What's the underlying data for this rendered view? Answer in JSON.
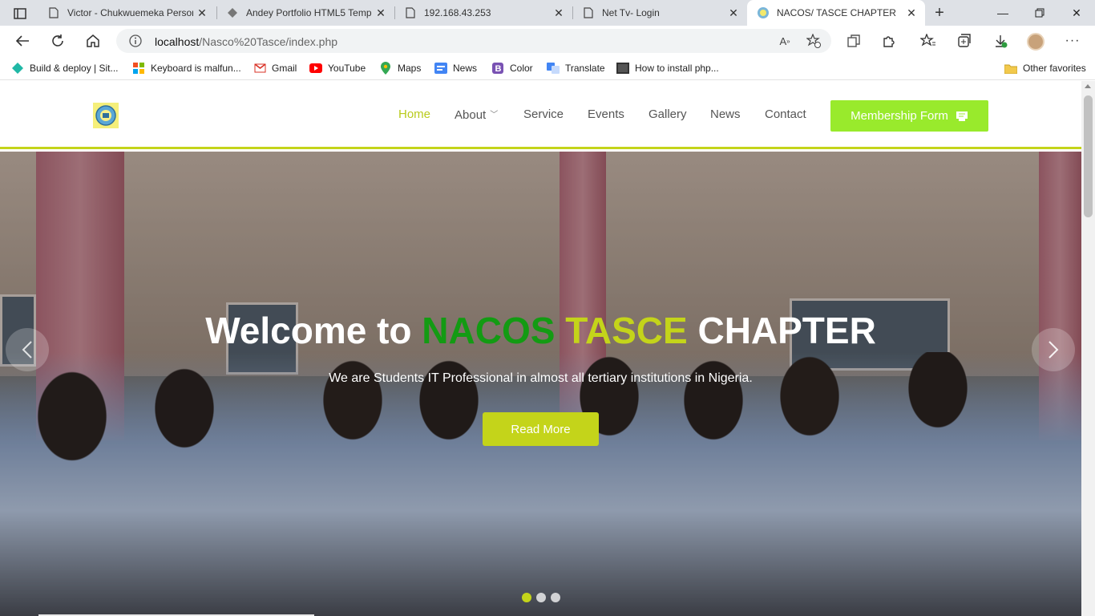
{
  "browser": {
    "tabs": [
      {
        "title": "Victor - Chukwuemeka Person",
        "icon": "page-icon"
      },
      {
        "title": "Andey Portfolio HTML5 Temp",
        "icon": "template-icon"
      },
      {
        "title": "192.168.43.253",
        "icon": "page-icon"
      },
      {
        "title": "Net Tv- Login",
        "icon": "page-icon"
      },
      {
        "title": "NACOS/ TASCE CHAPTER",
        "icon": "nacos-logo-icon",
        "active": true
      }
    ],
    "url_host": "localhost",
    "url_path": "/Nasco%20Tasce/index.php",
    "bookmarks": [
      {
        "label": "Build & deploy | Sit...",
        "icon": "netlify-icon",
        "color": "#20b8a6"
      },
      {
        "label": "Keyboard is malfun...",
        "icon": "windows-icon",
        "color": "#f25022"
      },
      {
        "label": "Gmail",
        "icon": "gmail-icon",
        "color": "#d93025"
      },
      {
        "label": "YouTube",
        "icon": "youtube-icon",
        "color": "#ff0000"
      },
      {
        "label": "Maps",
        "icon": "maps-icon",
        "color": "#34a853"
      },
      {
        "label": "News",
        "icon": "news-icon",
        "color": "#4285f4"
      },
      {
        "label": "Color",
        "icon": "bootstrap-icon",
        "color": "#7952b3"
      },
      {
        "label": "Translate",
        "icon": "translate-icon",
        "color": "#4285f4"
      },
      {
        "label": "How to install php...",
        "icon": "video-icon",
        "color": "#333333"
      }
    ],
    "other_favorites": "Other favorites"
  },
  "site": {
    "nav": {
      "home": "Home",
      "about": "About",
      "service": "Service",
      "events": "Events",
      "gallery": "Gallery",
      "news": "News",
      "contact": "Contact",
      "membership": "Membership Form"
    },
    "hero": {
      "title_prefix": "Welcome to ",
      "title_green": "NACOS",
      "title_yellow": "TASCE",
      "title_suffix": "CHAPTER",
      "subtitle": "We are Students IT Professional in almost all tertiary institutions in Nigeria.",
      "button": "Read More",
      "slides": 3,
      "active_slide": 1
    }
  },
  "colors": {
    "accent_yellow": "#c4d41a",
    "accent_green": "#139b13",
    "membership_button": "#99ea2c"
  }
}
